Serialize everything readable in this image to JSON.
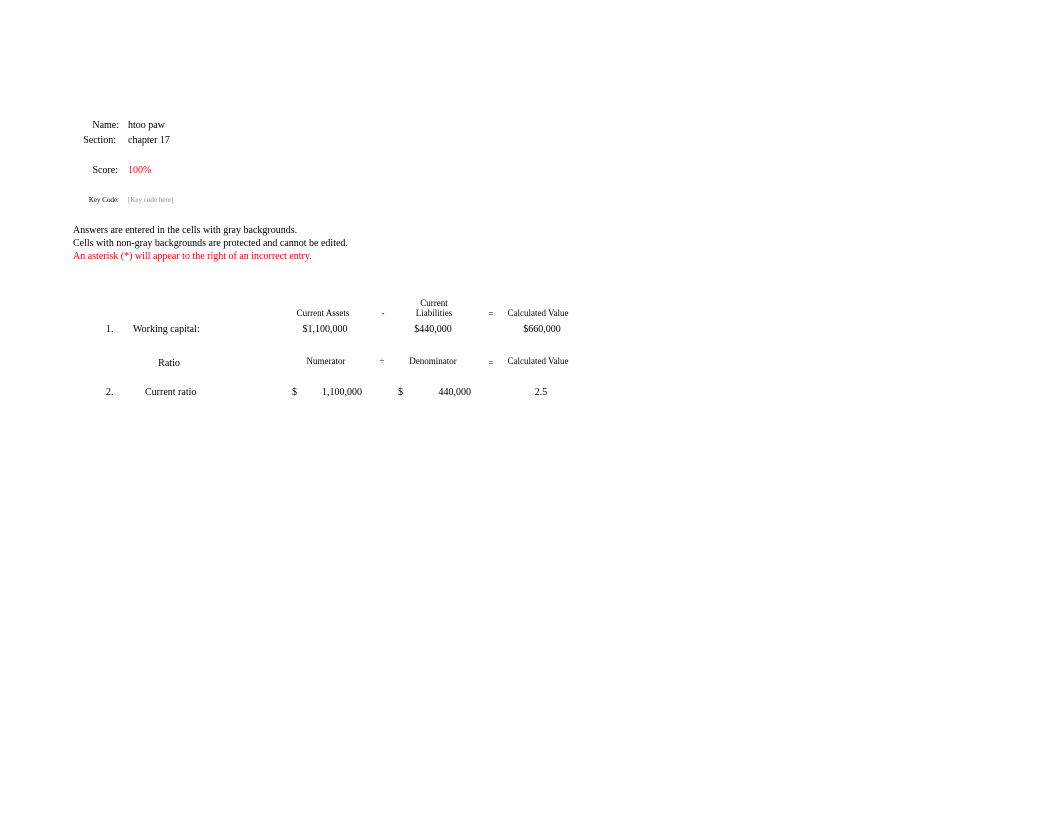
{
  "header": {
    "name_label": "Name:",
    "name_value": "htoo paw",
    "section_label": "Section:",
    "section_value": "chapter 17",
    "score_label": "Score:",
    "score_value": "100%",
    "keycode_label": "Key Code:",
    "keycode_placeholder": "[Key code here]"
  },
  "instructions": {
    "line1": "Answers are entered in the cells with gray backgrounds.",
    "line2": "Cells with non-gray backgrounds are protected and cannot be edited.",
    "line3": "An asterisk (*) will appear to the right of an incorrect entry."
  },
  "colors": {
    "score": "#ff0000",
    "warning": "#ff0000",
    "placeholder": "#8c8c8c"
  },
  "q1": {
    "col_current_assets": "Current Assets",
    "op_minus": "-",
    "col_current_liabilities_1": "Current",
    "col_current_liabilities_2": "Liabilities",
    "op_equals": "=",
    "col_calculated": "Calculated Value",
    "number": "1.",
    "label": "Working capital:",
    "current_assets": "$1,100,000",
    "current_liabilities": "$440,000",
    "calculated_value": "$660,000"
  },
  "q2": {
    "col_ratio": "Ratio",
    "col_numerator": "Numerator",
    "op_divide": "÷",
    "col_denominator": "Denominator",
    "op_equals": "=",
    "col_calculated": "Calculated Value",
    "number": "2.",
    "label": "Current ratio",
    "numerator_currency": "$",
    "numerator": "1,100,000",
    "denominator_currency": "$",
    "denominator": "440,000",
    "calculated_value": "2.5"
  }
}
